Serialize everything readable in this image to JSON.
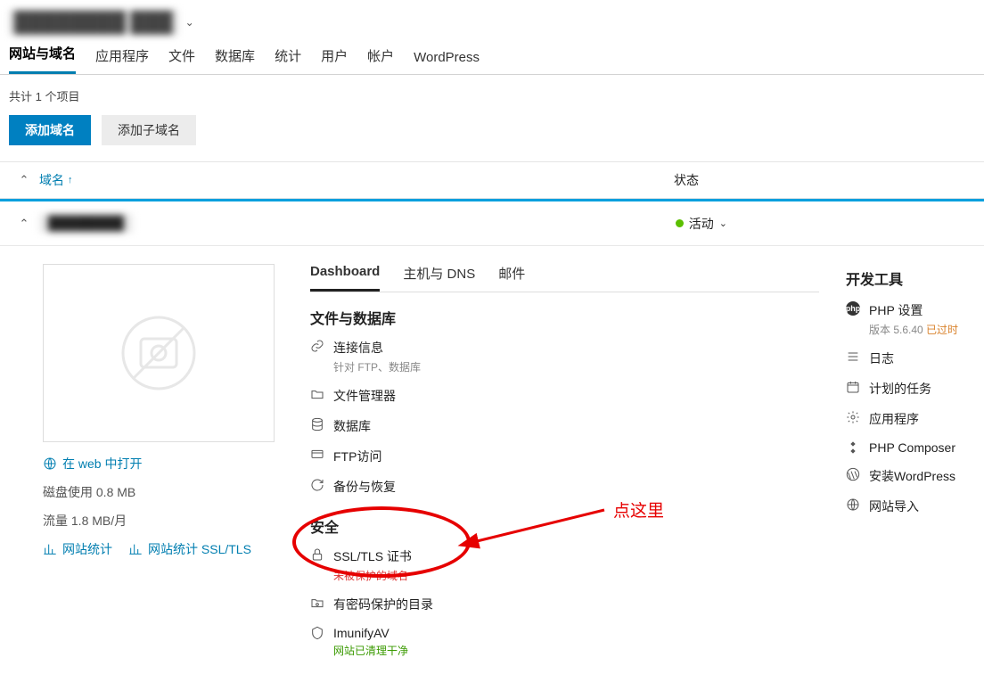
{
  "header": {
    "title_hidden": "████████ ███",
    "tabs": [
      "网站与域名",
      "应用程序",
      "文件",
      "数据库",
      "统计",
      "用户",
      "帐户",
      "WordPress"
    ],
    "active_tab_index": 0
  },
  "summary": "共计 1 个项目",
  "actions": {
    "primary": "添加域名",
    "secondary": "添加子域名"
  },
  "list_header": {
    "col_domain": "域名",
    "col_status": "状态"
  },
  "domain_item": {
    "name_hidden": "████████",
    "status_label": "活动",
    "sub_tabs": [
      "Dashboard",
      "主机与 DNS",
      "邮件"
    ],
    "active_sub_tab_index": 0,
    "left": {
      "open_web": "在 web 中打开",
      "disk_usage_label": "磁盘使用",
      "disk_usage_value": "0.8 MB",
      "traffic_label": "流量",
      "traffic_value": "1.8 MB/月",
      "stats": "网站统计",
      "stats_ssl": "网站统计 SSL/TLS"
    },
    "sections": {
      "files_db": {
        "title": "文件与数据库",
        "items": [
          {
            "icon": "link-icon",
            "label": "连接信息",
            "sub": "针对 FTP、数据库"
          },
          {
            "icon": "folder-icon",
            "label": "文件管理器"
          },
          {
            "icon": "database-icon",
            "label": "数据库"
          },
          {
            "icon": "ftp-icon",
            "label": "FTP访问"
          },
          {
            "icon": "backup-icon",
            "label": "备份与恢复"
          }
        ]
      },
      "security": {
        "title": "安全",
        "items": [
          {
            "icon": "lock-icon",
            "label": "SSL/TLS 证书",
            "sub": "未被保护的域名",
            "sub_class": "red"
          },
          {
            "icon": "shield-folder-icon",
            "label": "有密码保护的目录"
          },
          {
            "icon": "imunify-icon",
            "label": "ImunifyAV",
            "sub": "网站已清理干净",
            "sub_class": "green"
          }
        ]
      }
    },
    "dev_tools": {
      "title": "开发工具",
      "items": [
        {
          "icon": "php-badge",
          "label": "PHP 设置",
          "sub_prefix": "版本 ",
          "sub_version": "5.6.40",
          "sub_suffix": " 已过时"
        },
        {
          "icon": "list-icon",
          "label": "日志"
        },
        {
          "icon": "calendar-icon",
          "label": "计划的任务"
        },
        {
          "icon": "gear-icon",
          "label": "应用程序"
        },
        {
          "icon": "composer-icon",
          "label": "PHP Composer"
        },
        {
          "icon": "wordpress-icon",
          "label": "安装WordPress"
        },
        {
          "icon": "globe-icon",
          "label": "网站导入"
        }
      ]
    }
  },
  "annotation": {
    "text": "点这里"
  }
}
